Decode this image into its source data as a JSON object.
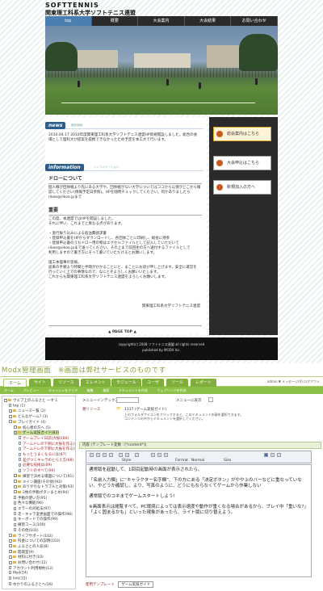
{
  "site": {
    "logo": "SOFTTENNIS",
    "title": "関東理工科系大学ソフトテニス連盟",
    "nav": [
      "top",
      "概要",
      "大会案内",
      "大会結果",
      "お問い合わせ"
    ],
    "news_tag": "news",
    "news_sub": "最新情報",
    "news_text": "2010.04.17 2010年度関東理工科系大学ソフトテニス連盟HP新規開設しました。総合の会場として理科大が提案を提携できなかったため予定を本工大で行います。",
    "info_tag": "information",
    "info_sub": "インフォメーション",
    "draw_heading": "ドローについて",
    "draw_text": "個人戦が団体戦より先にある大学や、団体戦がない大学についてはココから公領がどこから確認してください(情報予定日参照)。HPを随時チェックしてください。何かありましたらrikoe@rikoe.jpまで",
    "notice_heading": "重要",
    "notice_text": [
      "この度、本連盟ではHPを開設しました。",
      "それに伴い、これまでと異なる点があります。",
      "",
      "・旅行振り込みによる宿泊費請求書",
      "・登録申込書をHPからダウンロードし、各団体ごとに印刷し、総会に持参",
      "・登録申込書のうちドロー用の物はエクセルファイルとして記入していただいて",
      "rikoe@rikoe.jpまで送ってください。その上まで前回生の方へ送付するファイルとして",
      "利用しますので書き方にそって書いていただけるとお願いします。",
      "",
      "理工本理事の皆様。",
      "従来の手順より時間と手間がかかることにと、まことにお詫び申し上げます。安全に運営を",
      "行っていく上での事情なので、なにとぞよろしくお願いいたします。",
      "これからも関東理工科系大学ソフトテニス連盟をよろしくお願いします。"
    ],
    "signature": "関東理工科系大学ソフトテニス連盟",
    "page_top": "▲ PAGE TOP ▲",
    "side_buttons": [
      "総会案内はこちら",
      "大会申込はこちら",
      "新規加入の方へ"
    ],
    "footer": [
      "copyright(c) 2008 ソフトテニス連盟 all rights reserved",
      "published by MODX Inc."
    ]
  },
  "caption": "Modx管理画面　※画面は弊社サービスのものです",
  "admin": {
    "tabs": [
      "ホーム",
      "サイト",
      "リソース",
      "エレメント",
      "モジュール",
      "ユーザ",
      "ツール",
      "レポート"
    ],
    "subtabs": [
      "ホーム",
      "プレビュー",
      "キャッシュをクリア",
      "編集",
      "検索",
      "ドキュメントを作成",
      "ウェブリンクを作成"
    ],
    "user": "admin ▼ メッセージ(0) ログアウト",
    "tree": [
      {
        "label": "ウェブ上のふるさと 一す 1",
        "depth": 0,
        "kind": "folder"
      },
      {
        "label": "top (1)",
        "depth": 1,
        "kind": "doc"
      },
      {
        "label": "ニュース一覧 (2)",
        "depth": 1,
        "kind": "folder"
      },
      {
        "label": "どんなゲーム? (3)",
        "depth": 1,
        "kind": "folder"
      },
      {
        "label": "プレイガイド (4)",
        "depth": 1,
        "kind": "folder"
      },
      {
        "label": "初心者の方へ (5)",
        "depth": 2,
        "kind": "folder"
      },
      {
        "label": "ゲーム実技ガイド(83)",
        "depth": 2,
        "kind": "folder"
      },
      {
        "label": "ゲームプレイ日誌(大振)(84)",
        "depth": 3,
        "kind": "doc"
      },
      {
        "label": "アームドレの下側に大振を作る(85)",
        "depth": 3,
        "kind": "doc"
      },
      {
        "label": "アームドレの下側に大振を作る(86)",
        "depth": 3,
        "kind": "doc"
      },
      {
        "label": "もっとうまくなるには(87)",
        "depth": 3,
        "kind": "doc"
      },
      {
        "label": "差がつくキャラのとらえ方(88)",
        "depth": 3,
        "kind": "doc"
      },
      {
        "label": "必要な技術は(89)",
        "depth": 3,
        "kind": "doc"
      },
      {
        "label": "ソフトのすべて(90)",
        "depth": 3,
        "kind": "doc"
      },
      {
        "label": "練習で決める場面について(91)",
        "depth": 2,
        "kind": "folder"
      },
      {
        "label": "メイン講座(その他)(92)",
        "depth": 2,
        "kind": "folder"
      },
      {
        "label": "ありがちなトラブルと対策(93)",
        "depth": 2,
        "kind": "folder"
      },
      {
        "label": "2枚の手動ボタンまとめ(94)",
        "depth": 2,
        "kind": "folder"
      },
      {
        "label": "手動の使い方(95)",
        "depth": 2,
        "kind": "doc"
      },
      {
        "label": "色々な機能(96)",
        "depth": 2,
        "kind": "doc"
      },
      {
        "label": "エラーの対処法(97)",
        "depth": 2,
        "kind": "doc"
      },
      {
        "label": "走・キャラ変更画面での操作(98)",
        "depth": 2,
        "kind": "doc"
      },
      {
        "label": "キーボードでの操作(99)",
        "depth": 2,
        "kind": "doc"
      },
      {
        "label": "練習コース(100)",
        "depth": 2,
        "kind": "doc"
      },
      {
        "label": "その他(101)",
        "depth": 2,
        "kind": "doc"
      },
      {
        "label": "ライフサポート(102)",
        "depth": 1,
        "kind": "folder"
      },
      {
        "label": "料金についての説明(103)",
        "depth": 1,
        "kind": "folder"
      },
      {
        "label": "ふるさとの人気(8)",
        "depth": 1,
        "kind": "folder"
      },
      {
        "label": "開発室(9)",
        "depth": 1,
        "kind": "folder"
      },
      {
        "label": "材料に付き(10)",
        "depth": 1,
        "kind": "folder"
      },
      {
        "label": "お問い合わせ(11)",
        "depth": 1,
        "kind": "folder"
      },
      {
        "label": "アカウント利用規約(12)",
        "depth": 1,
        "kind": "doc"
      },
      {
        "label": "Mail(14)",
        "depth": 1,
        "kind": "doc"
      },
      {
        "label": "link(15)",
        "depth": 1,
        "kind": "doc"
      },
      {
        "label": "ゆかりのふるさとへ(16)",
        "depth": 1,
        "kind": "doc"
      }
    ],
    "fields": {
      "menu_index_label": "メニューインデックス",
      "menu_hide_label": "メニューに表示",
      "template_var_label": "親リソース",
      "template_var_value": "1137 (ゲーム実技ガイド)",
      "note": "上のフォルダアイコンをクリックすると、このドキュメントの親を選択できます。コンテンツの中からドキュメントを選択してください。"
    },
    "content_label": "内容 (テンプレート変数 : [*content*])",
    "toolbar": {
      "style": "Style",
      "format": "Format",
      "format_val": "Normal",
      "size": "Size"
    },
    "editor_text": [
      "通常版を起動して、1回目起動時の画面が表示されたら、",
      "「名前入力欄」に“キャラクター名字欄”、下の方にある「決定ボタン」がやや上のバーなどに重なっていない、やどうか確認し、より、写真のように、どうにもならなくてゲームから作業しない",
      "通常版でのコネまでゲームスタートしよう!",
      "※画面表示は閲覧すべて。PC環境によっては表示速度や動作が重くなる場合があるから、プレイ中「重いな?」「よく固まるかも」といった現象があったら、ライト版に切り替えよう。"
    ],
    "template_label": "使用テンプレート",
    "template_value": "ゲーム実技ガイド"
  }
}
